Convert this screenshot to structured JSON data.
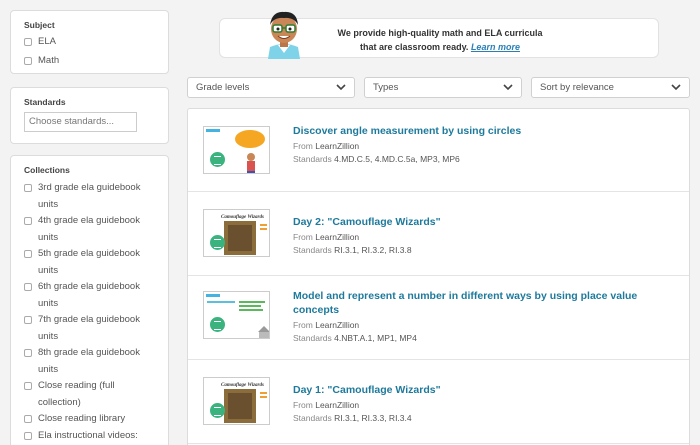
{
  "sidebar": {
    "subject": {
      "title": "Subject",
      "options": [
        {
          "label": "ELA"
        },
        {
          "label": "Math"
        }
      ]
    },
    "standards": {
      "title": "Standards",
      "placeholder": "Choose standards..."
    },
    "collections": {
      "title": "Collections",
      "items": [
        {
          "label": "3rd grade ela guidebook units"
        },
        {
          "label": "4th grade ela guidebook units"
        },
        {
          "label": "5th grade ela guidebook units"
        },
        {
          "label": "6th grade ela guidebook units"
        },
        {
          "label": "7th grade ela guidebook units"
        },
        {
          "label": "8th grade ela guidebook units"
        },
        {
          "label": "Close reading (full collection)"
        },
        {
          "label": "Close reading library"
        },
        {
          "label": "Ela instructional videos: writealong and more"
        }
      ]
    }
  },
  "banner": {
    "line1": "We provide high-quality math and ELA curricula",
    "line2": "that are classroom ready.",
    "link": "Learn more"
  },
  "filters": {
    "grade": "Grade levels",
    "types": "Types",
    "sort": "Sort by relevance"
  },
  "results": [
    {
      "title": "Discover angle measurement by using circles",
      "from_label": "From",
      "from": "LearnZillion",
      "standards_label": "Standards",
      "standards": "4.MD.C.5, 4.MD.C.5a, MP3, MP6"
    },
    {
      "title": "Day 2: \"Camouflage Wizards\"",
      "from_label": "From",
      "from": "LearnZillion",
      "standards_label": "Standards",
      "standards": "RI.3.1, RI.3.2, RI.3.8",
      "thumb_heading": "Camouflage Wizards"
    },
    {
      "title": "Model and represent a number in different ways by using place value concepts",
      "from_label": "From",
      "from": "LearnZillion",
      "standards_label": "Standards",
      "standards": "4.NBT.A.1, MP1, MP4"
    },
    {
      "title": "Day 1: \"Camouflage Wizards\"",
      "from_label": "From",
      "from": "LearnZillion",
      "standards_label": "Standards",
      "standards": "RI.3.1, RI.3.3, RI.3.4",
      "thumb_heading": "Camouflage Wizards"
    }
  ],
  "colors": {
    "accent": "#1e7a9c",
    "badge": "#3bb37e",
    "link": "#2a7fb5"
  }
}
